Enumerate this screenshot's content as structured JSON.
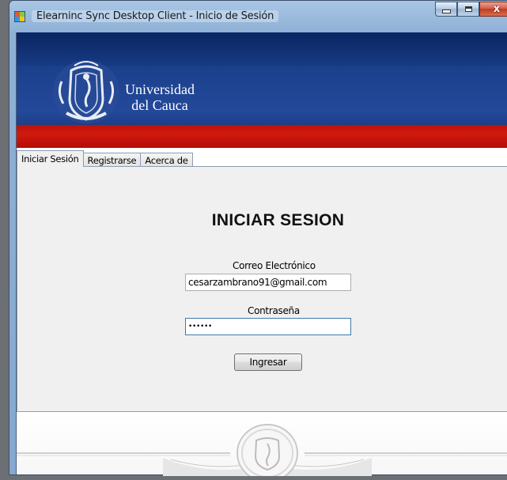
{
  "window": {
    "title": "Elearninc Sync Desktop Client - Inicio de Sesión",
    "close_glyph": "x"
  },
  "banner": {
    "line1": "Universidad",
    "line2": "del Cauca"
  },
  "tabs": [
    {
      "label": "Iniciar Sesión",
      "active": true
    },
    {
      "label": "Registrarse",
      "active": false
    },
    {
      "label": "Acerca de",
      "active": false
    }
  ],
  "login": {
    "heading": "INICIAR SESION",
    "email_label": "Correo Electrónico",
    "email_value": "cesarzambrano91@gmail.com",
    "password_label": "Contraseña",
    "password_mask": "••••••",
    "submit_label": "Ingresar"
  },
  "colors": {
    "banner_blue": "#1a3f8a",
    "banner_red": "#c01008"
  }
}
